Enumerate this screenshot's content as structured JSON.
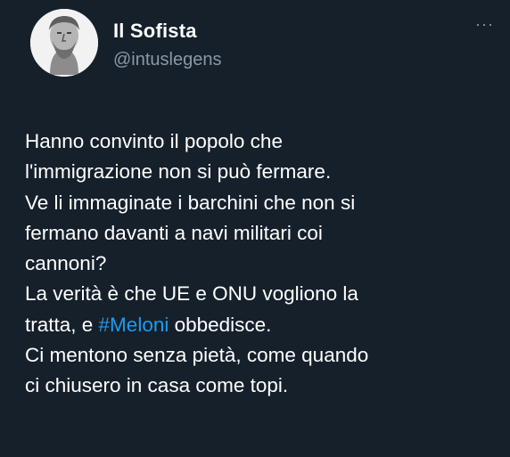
{
  "author": {
    "display_name": "Il Sofista",
    "handle": "@intuslegens",
    "avatar_icon": "philosopher-bust-avatar"
  },
  "menu_icon": "more-options-icon",
  "menu_glyph": "···",
  "tweet": {
    "lines": [
      "Hanno convinto il popolo che",
      "l'immigrazione non si può fermare.",
      "Ve li immaginate i barchini che non si",
      "fermano davanti a navi militari coi",
      "cannoni?",
      "La verità è che UE e ONU vogliono la",
      "tratta, e ",
      "Ci mentono senza pietà, come quando",
      "ci chiusero in casa come topi."
    ],
    "hashtag": "#Meloni",
    "after_hashtag": " obbedisce."
  },
  "colors": {
    "background": "#15202b",
    "text": "#ffffff",
    "secondary": "#8b98a5",
    "link": "#1d9bf0"
  }
}
